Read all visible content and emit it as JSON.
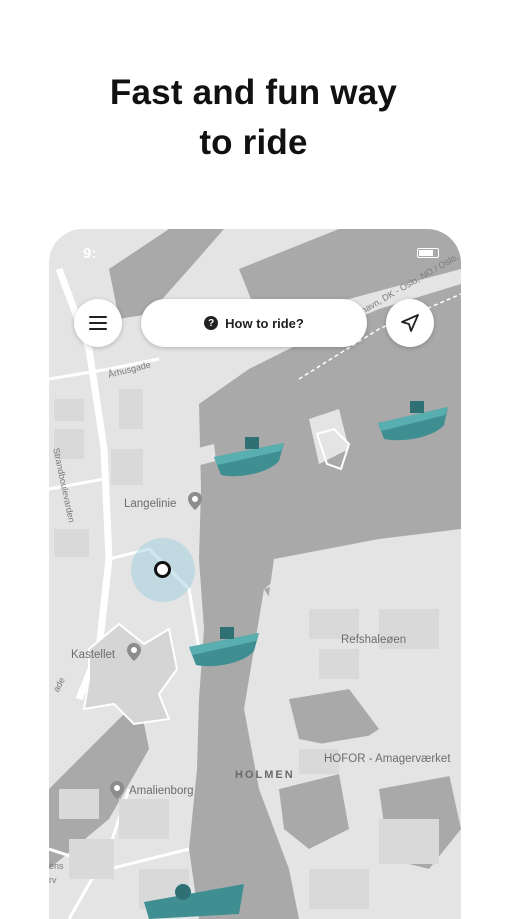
{
  "headline": {
    "line1": "Fast and fun way",
    "line2": "to ride"
  },
  "status_bar": {
    "time": "9:"
  },
  "controls": {
    "menu_icon": "hamburger-menu-icon",
    "how_to_ride_label": "How to ride?",
    "help_icon": "question-mark-icon",
    "locate_icon": "navigation-arrow-icon"
  },
  "map": {
    "labels": {
      "aarhusgade": "Århusgade",
      "strandboulevarden": "Strandboulevarden",
      "langelinie": "Langelinie",
      "kastellet": "Kastellet",
      "refshaleoen": "Refshaleøen",
      "holmen": "HOLMEN",
      "hofor": "HOFOR - Amagerværket",
      "amalienborg": "Amalienborg",
      "ferry_route": "havn, DK - Oslo, NO / Oslo,",
      "ens": "ens",
      "rv": "rv",
      "ade": "ade"
    },
    "water_color": "#a9a9a9",
    "land_color": "#e4e4e4",
    "boat_color": "#3f8f92"
  }
}
